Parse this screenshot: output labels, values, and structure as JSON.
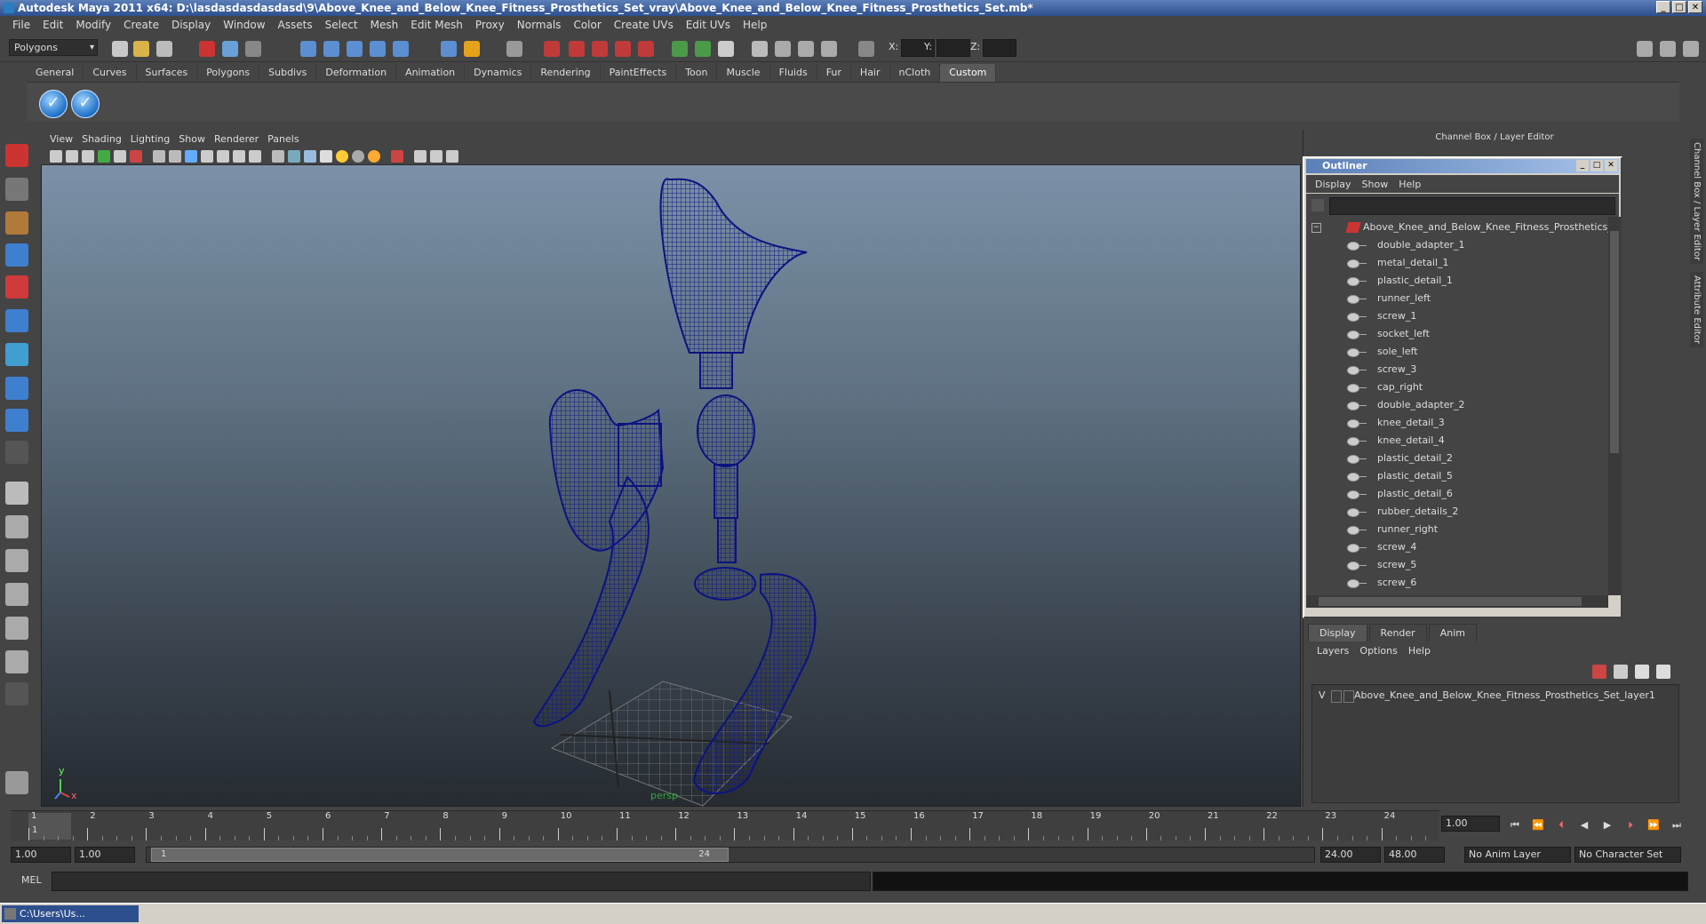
{
  "window": {
    "title": "Autodesk Maya 2011 x64: D:\\lasdasdasdasdasd\\9\\Above_Knee_and_Below_Knee_Fitness_Prosthetics_Set_vray\\Above_Knee_and_Below_Knee_Fitness_Prosthetics_Set.mb*",
    "min": "_",
    "max": "□",
    "close": "✕"
  },
  "menubar": [
    "File",
    "Edit",
    "Modify",
    "Create",
    "Display",
    "Window",
    "Assets",
    "Select",
    "Mesh",
    "Edit Mesh",
    "Proxy",
    "Normals",
    "Color",
    "Create UVs",
    "Edit UVs",
    "Help"
  ],
  "statusline": {
    "mode": "Polygons",
    "x_label": "X:",
    "y_label": "Y:",
    "z_label": "Z:"
  },
  "shelf": {
    "tabs": [
      "General",
      "Curves",
      "Surfaces",
      "Polygons",
      "Subdivs",
      "Deformation",
      "Animation",
      "Dynamics",
      "Rendering",
      "PaintEffects",
      "Toon",
      "Muscle",
      "Fluids",
      "Fur",
      "Hair",
      "nCloth",
      "Custom"
    ],
    "active": "Custom",
    "buttons": [
      "✓",
      "✓"
    ]
  },
  "viewport": {
    "menu": [
      "View",
      "Shading",
      "Lighting",
      "Show",
      "Renderer",
      "Panels"
    ],
    "axis_y": "y",
    "axis_x": "x",
    "camera_label": "persp"
  },
  "right_panel": {
    "title": "Channel Box / Layer Editor",
    "side_tabs": [
      "Channel Box / Layer Editor",
      "Attribute Editor"
    ]
  },
  "outliner": {
    "title": "Outliner",
    "menu": [
      "Display",
      "Show",
      "Help"
    ],
    "root": "Above_Knee_and_Below_Knee_Fitness_Prosthetics_S",
    "items": [
      "double_adapter_1",
      "metal_detail_1",
      "plastic_detail_1",
      "runner_left",
      "screw_1",
      "socket_left",
      "sole_left",
      "screw_3",
      "cap_right",
      "double_adapter_2",
      "knee_detail_3",
      "knee_detail_4",
      "plastic_detail_2",
      "plastic_detail_5",
      "plastic_detail_6",
      "rubber_details_2",
      "runner_right",
      "screw_4",
      "screw_5",
      "screw_6"
    ]
  },
  "layer_editor": {
    "tabs": [
      "Display",
      "Render",
      "Anim"
    ],
    "active": "Display",
    "menu": [
      "Layers",
      "Options",
      "Help"
    ],
    "layer_visible": "V",
    "layer_name": "Above_Knee_and_Below_Knee_Fitness_Prosthetics_Set_layer1"
  },
  "timeline": {
    "ticks": [
      "1",
      "2",
      "3",
      "4",
      "5",
      "6",
      "7",
      "8",
      "9",
      "10",
      "11",
      "12",
      "13",
      "14",
      "15",
      "16",
      "17",
      "18",
      "19",
      "20",
      "21",
      "22",
      "23",
      "24"
    ],
    "current_frame": "1.00",
    "current_marker": "1"
  },
  "range": {
    "start": "1.00",
    "start2": "1.00",
    "handle_start": "1",
    "handle_end": "24",
    "end": "24.00",
    "end2": "48.00",
    "anim_layer": "No Anim Layer",
    "character_set": "No Character Set"
  },
  "cmdline": {
    "label": "MEL"
  },
  "taskbar": {
    "item": "C:\\Users\\Us..."
  }
}
